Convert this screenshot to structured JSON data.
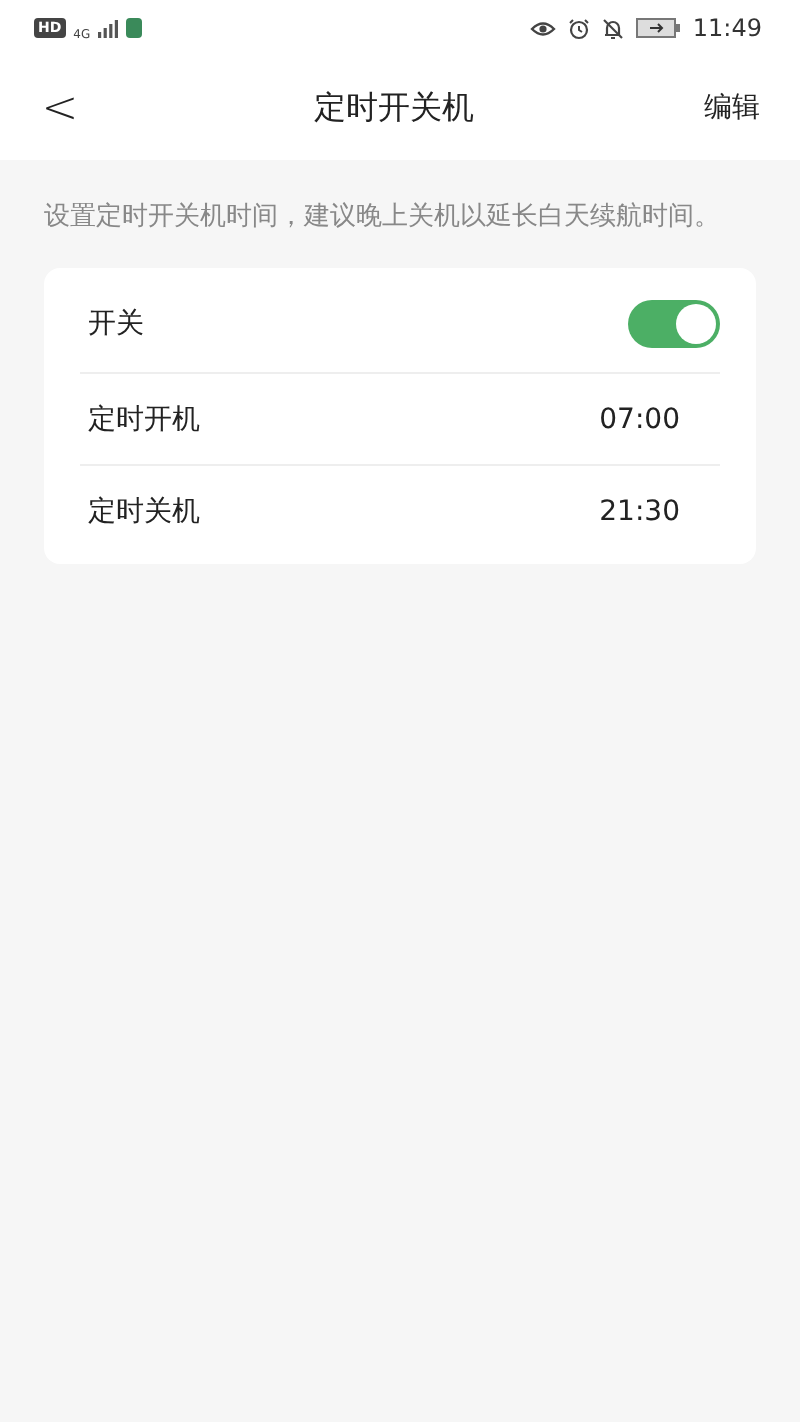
{
  "status_bar": {
    "network_badge": "HD",
    "network_type": "4G",
    "time": "11:49"
  },
  "header": {
    "back": "<",
    "title": "定时开关机",
    "action": "编辑"
  },
  "description": "设置定时开关机时间，建议晚上关机以延长白天续航时间。",
  "settings": [
    {
      "kind": "toggle",
      "label": "开关",
      "on": true
    },
    {
      "kind": "time",
      "label": "定时开机",
      "value": "07:00"
    },
    {
      "kind": "time",
      "label": "定时关机",
      "value": "21:30"
    }
  ]
}
